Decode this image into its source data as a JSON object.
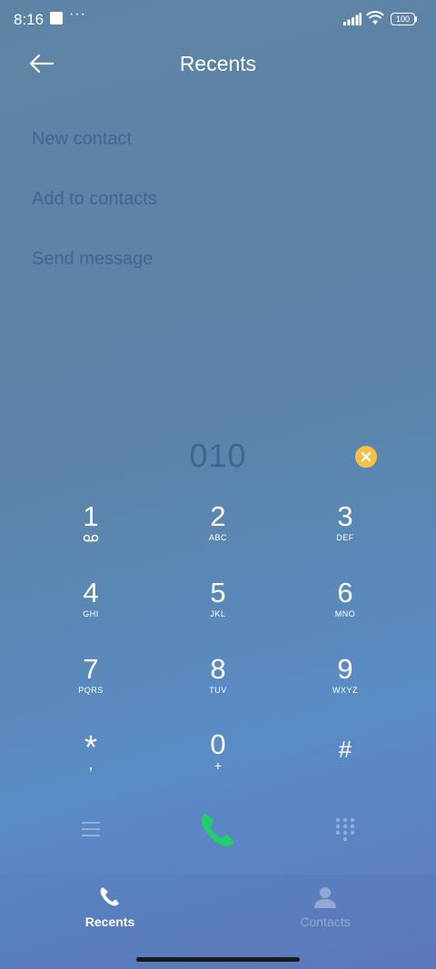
{
  "status_bar": {
    "time": "8:16",
    "dots": "···",
    "battery": "100",
    "icons": [
      "notification-square-icon",
      "signal-icon",
      "wifi-icon",
      "battery-icon"
    ]
  },
  "header": {
    "title": "Recents",
    "back_icon": "arrow-left-icon"
  },
  "options": [
    {
      "label": "New contact"
    },
    {
      "label": "Add to contacts"
    },
    {
      "label": "Send message"
    }
  ],
  "dialer": {
    "number": "010",
    "clear_icon": "clear-x-icon"
  },
  "keypad": [
    {
      "digit": "1",
      "letters": "",
      "icon": "voicemail-icon"
    },
    {
      "digit": "2",
      "letters": "ABC"
    },
    {
      "digit": "3",
      "letters": "DEF"
    },
    {
      "digit": "4",
      "letters": "GHI"
    },
    {
      "digit": "5",
      "letters": "JKL"
    },
    {
      "digit": "6",
      "letters": "MNO"
    },
    {
      "digit": "7",
      "letters": "PQRS"
    },
    {
      "digit": "8",
      "letters": "TUV"
    },
    {
      "digit": "9",
      "letters": "WXYZ"
    },
    {
      "digit": "*",
      "letters": ","
    },
    {
      "digit": "0",
      "letters": "+"
    },
    {
      "digit": "#",
      "letters": ""
    }
  ],
  "actions": {
    "menu_icon": "menu-icon",
    "call_icon": "phone-icon",
    "dialpad_icon": "dialpad-icon",
    "call_color": "#1fd06b"
  },
  "tabs": [
    {
      "label": "Recents",
      "icon": "phone-icon",
      "active": true
    },
    {
      "label": "Contacts",
      "icon": "person-icon",
      "active": false
    }
  ],
  "colors": {
    "clear_button": "#f6c043",
    "muted_text": "#3f6590"
  }
}
